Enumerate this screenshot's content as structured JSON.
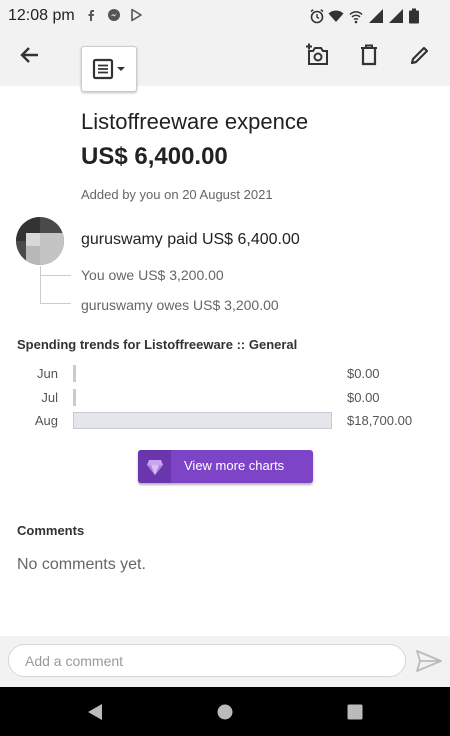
{
  "status_bar": {
    "time": "12:08 pm",
    "notification_icons": [
      "facebook-icon",
      "messenger-icon",
      "play-store-icon"
    ],
    "system_icons": [
      "alarm-icon",
      "wifi-icon",
      "hotspot-icon",
      "signal-icon",
      "signal-icon",
      "battery-icon"
    ]
  },
  "toolbar": {
    "icons": [
      "back-arrow-icon",
      "receipt-icon",
      "camera-add-icon",
      "trash-icon",
      "pencil-icon"
    ]
  },
  "expense": {
    "title": "Listoffreeware expence",
    "amount": "US$ 6,400.00",
    "added_by": "Added by you on 20 August 2021",
    "payer_line": "guruswamy paid US$ 6,400.00",
    "shares": [
      "You owe US$ 3,200.00",
      "guruswamy owes US$ 3,200.00"
    ]
  },
  "spending": {
    "title": "Spending trends for Listoffreeware :: General",
    "rows": [
      {
        "month": "Jun",
        "value": "$0.00",
        "amount": 0
      },
      {
        "month": "Jul",
        "value": "$0.00",
        "amount": 0
      },
      {
        "month": "Aug",
        "value": "$18,700.00",
        "amount": 18700
      }
    ],
    "max_amount": 18700,
    "button_label": "View more charts"
  },
  "comments": {
    "title": "Comments",
    "empty_text": "No comments yet.",
    "input_placeholder": "Add a comment"
  },
  "colors": {
    "accent_purple": "#7e44c7",
    "bar_fill": "#e5e6ec"
  }
}
